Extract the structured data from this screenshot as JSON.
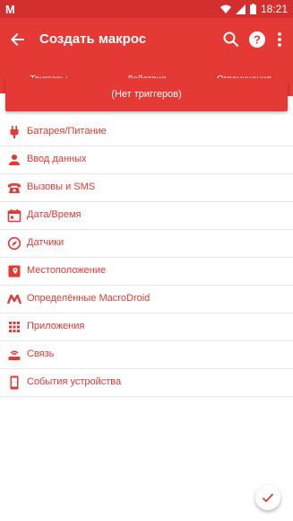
{
  "status_bar": {
    "app_letter": "M",
    "time": "18:21"
  },
  "toolbar": {
    "title": "Создать макрос"
  },
  "tabs": [
    {
      "label": "Триггеры"
    },
    {
      "label": "Действия"
    },
    {
      "label": "Ограничения"
    }
  ],
  "banner": {
    "text": "(Нет триггеров)"
  },
  "categories": [
    {
      "label": "Батарея/Питание",
      "icon": "plug-icon"
    },
    {
      "label": "Ввод данных",
      "icon": "person-icon"
    },
    {
      "label": "Вызовы и SMS",
      "icon": "phone-icon"
    },
    {
      "label": "Дата/Время",
      "icon": "calendar-icon"
    },
    {
      "label": "Датчики",
      "icon": "compass-icon"
    },
    {
      "label": "Местоположение",
      "icon": "map-icon"
    },
    {
      "label": "Определённые MacroDroid",
      "icon": "macrodroid-icon"
    },
    {
      "label": "Приложения",
      "icon": "apps-grid-icon"
    },
    {
      "label": "Связь",
      "icon": "router-icon"
    },
    {
      "label": "События устройства",
      "icon": "phone-device-icon"
    }
  ],
  "colors": {
    "accent": "#e53935",
    "status_bar": "#d32f2f"
  }
}
